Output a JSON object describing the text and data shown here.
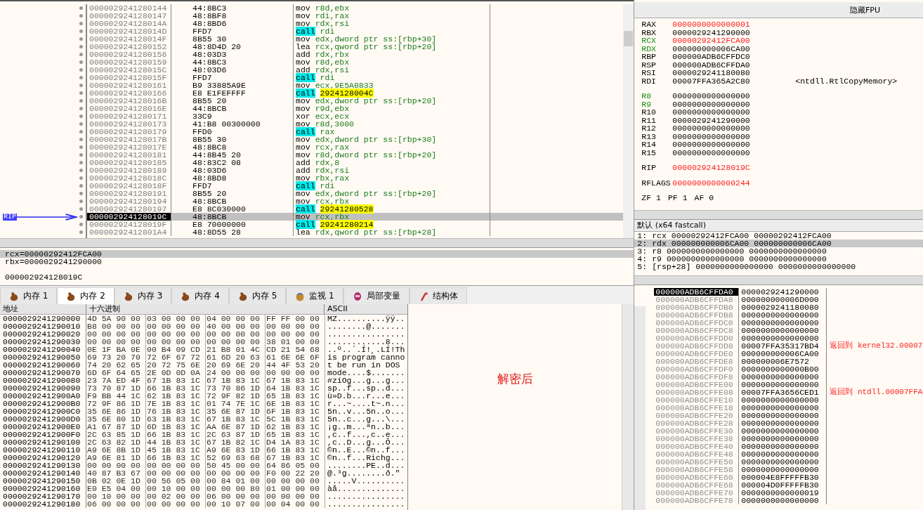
{
  "disassembly": {
    "rip_label": "RIP",
    "rows": [
      {
        "address": "0000029241280144",
        "bytes": "44:8BC3",
        "mnemonic": "mov",
        "operands": "r8d,ebx",
        "kind": "plain",
        "selected": false
      },
      {
        "address": "0000029241280147",
        "bytes": "48:8BF8",
        "mnemonic": "mov",
        "operands": "rdi,rax",
        "kind": "plain",
        "selected": false
      },
      {
        "address": "000002924128014A",
        "bytes": "48:8BD6",
        "mnemonic": "mov",
        "operands": "rdx,rsi",
        "kind": "plain",
        "selected": false
      },
      {
        "address": "000002924128014D",
        "bytes": "FFD7",
        "mnemonic": "call",
        "operands": "rdi",
        "kind": "call",
        "selected": false
      },
      {
        "address": "000002924128014F",
        "bytes": "8B55 30",
        "mnemonic": "mov",
        "operands": "edx,dword ptr ss:[rbp+30]",
        "kind": "plain",
        "selected": false
      },
      {
        "address": "0000029241280152",
        "bytes": "48:8D4D 20",
        "mnemonic": "lea",
        "operands": "rcx,qword ptr ss:[rbp+20]",
        "kind": "plain",
        "selected": false
      },
      {
        "address": "0000029241280156",
        "bytes": "48:03D3",
        "mnemonic": "add",
        "operands": "rdx,rbx",
        "kind": "plain",
        "selected": false
      },
      {
        "address": "0000029241280159",
        "bytes": "44:8BC3",
        "mnemonic": "mov",
        "operands": "r8d,ebx",
        "kind": "plain",
        "selected": false
      },
      {
        "address": "000002924128015C",
        "bytes": "48:03D6",
        "mnemonic": "add",
        "operands": "rdx,rsi",
        "kind": "plain",
        "selected": false
      },
      {
        "address": "000002924128015F",
        "bytes": "FFD7",
        "mnemonic": "call",
        "operands": "rdi",
        "kind": "call",
        "selected": false
      },
      {
        "address": "0000029241280161",
        "bytes": "B9 33885A9E",
        "mnemonic": "mov",
        "operands": "ecx,9E5A8833",
        "kind": "plain",
        "selected": false
      },
      {
        "address": "0000029241280166",
        "bytes": "E8 E1FEFFFF",
        "mnemonic": "call",
        "operands": "2924128004C",
        "kind": "call_address",
        "selected": false
      },
      {
        "address": "000002924128016B",
        "bytes": "8B55 20",
        "mnemonic": "mov",
        "operands": "edx,dword ptr ss:[rbp+20]",
        "kind": "plain",
        "selected": false
      },
      {
        "address": "000002924128016E",
        "bytes": "44:8BCB",
        "mnemonic": "mov",
        "operands": "r9d,ebx",
        "kind": "plain",
        "selected": false
      },
      {
        "address": "0000029241280171",
        "bytes": "33C9",
        "mnemonic": "xor",
        "operands": "ecx,ecx",
        "kind": "plain",
        "selected": false
      },
      {
        "address": "0000029241280173",
        "bytes": "41:B8 00300000",
        "mnemonic": "mov",
        "operands": "r8d,3000",
        "kind": "plain",
        "selected": false
      },
      {
        "address": "0000029241280179",
        "bytes": "FFD0",
        "mnemonic": "call",
        "operands": "rax",
        "kind": "call",
        "selected": false
      },
      {
        "address": "000002924128017B",
        "bytes": "8B55 30",
        "mnemonic": "mov",
        "operands": "edx,dword ptr ss:[rbp+30]",
        "kind": "plain",
        "selected": false
      },
      {
        "address": "000002924128017E",
        "bytes": "48:8BC8",
        "mnemonic": "mov",
        "operands": "rcx,rax",
        "kind": "plain",
        "selected": false
      },
      {
        "address": "0000029241280181",
        "bytes": "44:8B45 20",
        "mnemonic": "mov",
        "operands": "r8d,dword ptr ss:[rbp+20]",
        "kind": "plain",
        "selected": false
      },
      {
        "address": "0000029241280185",
        "bytes": "48:83C2 08",
        "mnemonic": "add",
        "operands": "rdx,8",
        "kind": "plain",
        "selected": false
      },
      {
        "address": "0000029241280189",
        "bytes": "48:03D6",
        "mnemonic": "add",
        "operands": "rdx,rsi",
        "kind": "plain",
        "selected": false
      },
      {
        "address": "000002924128018C",
        "bytes": "48:8BD8",
        "mnemonic": "mov",
        "operands": "rbx,rax",
        "kind": "plain",
        "selected": false
      },
      {
        "address": "000002924128018F",
        "bytes": "FFD7",
        "mnemonic": "call",
        "operands": "rdi",
        "kind": "call",
        "selected": false
      },
      {
        "address": "0000029241280191",
        "bytes": "8B55 20",
        "mnemonic": "mov",
        "operands": "edx,dword ptr ss:[rbp+20]",
        "kind": "plain",
        "selected": false
      },
      {
        "address": "0000029241280194",
        "bytes": "48:8BCB",
        "mnemonic": "mov",
        "operands": "rcx,rbx",
        "kind": "plain",
        "selected": false
      },
      {
        "address": "0000029241280197",
        "bytes": "E8 8C030000",
        "mnemonic": "call",
        "operands": "29241280528",
        "kind": "call_address",
        "selected": false
      },
      {
        "address": "000002924128019C",
        "bytes": "48:8BCB",
        "mnemonic": "mov",
        "operands": "rcx,rbx",
        "kind": "plain",
        "selected": true
      },
      {
        "address": "000002924128019F",
        "bytes": "E8 70000000",
        "mnemonic": "call",
        "operands": "29241280214",
        "kind": "call_address",
        "selected": false
      },
      {
        "address": "00000292412801A4",
        "bytes": "48:8D55 28",
        "mnemonic": "lea",
        "operands": "rdx,qword ptr ss:[rbp+28]",
        "kind": "plain",
        "selected": false
      }
    ]
  },
  "info": {
    "lines": [
      {
        "text": "rcx=00000292412FCA00",
        "selected": true
      },
      {
        "text": "rbx=0000029241290000",
        "selected": false
      }
    ],
    "address": "000002924128019C"
  },
  "tabs": [
    {
      "label": "内存 1",
      "kind": "memory",
      "selected": false
    },
    {
      "label": "内存 2",
      "kind": "memory",
      "selected": true
    },
    {
      "label": "内存 3",
      "kind": "memory",
      "selected": false
    },
    {
      "label": "内存 4",
      "kind": "memory",
      "selected": false
    },
    {
      "label": "内存 5",
      "kind": "memory",
      "selected": false
    },
    {
      "label": "监视 1",
      "kind": "watch",
      "selected": false
    },
    {
      "label": "局部变量",
      "kind": "locals",
      "selected": false
    },
    {
      "label": "结构体",
      "kind": "struct",
      "selected": false
    }
  ],
  "dump": {
    "columns": [
      "地址",
      "十六进制",
      "ASCII"
    ],
    "annotation": "解密后",
    "rows": [
      {
        "address": "0000029241290000",
        "groups": [
          "4D 5A 90 00",
          "03 00 00 00",
          "04 00 00 00",
          "FF FF 00 00"
        ],
        "ascii": "MZ..........ÿÿ.."
      },
      {
        "address": "0000029241290010",
        "groups": [
          "B8 00 00 00",
          "00 00 00 00",
          "40 00 00 00",
          "00 00 00 00"
        ],
        "ascii": "........@......."
      },
      {
        "address": "0000029241290020",
        "groups": [
          "00 00 00 00",
          "00 00 00 00",
          "00 00 00 00",
          "00 00 00 00"
        ],
        "ascii": "................"
      },
      {
        "address": "0000029241290030",
        "groups": [
          "00 00 00 00",
          "00 00 00 00",
          "00 00 00 00",
          "38 01 00 00"
        ],
        "ascii": "............8..."
      },
      {
        "address": "0000029241290040",
        "groups": [
          "0E 1F BA 0E",
          "00 B4 09 CD",
          "21 B8 01 4C",
          "CD 21 54 68"
        ],
        "ascii": "..º..´.Í!¸.LÍ!Th"
      },
      {
        "address": "0000029241290050",
        "groups": [
          "69 73 20 70",
          "72 6F 67 72",
          "61 6D 20 63",
          "61 6E 6E 6F"
        ],
        "ascii": "is program canno"
      },
      {
        "address": "0000029241290060",
        "groups": [
          "74 20 62 65",
          "20 72 75 6E",
          "20 69 6E 20",
          "44 4F 53 20"
        ],
        "ascii": "t be run in DOS "
      },
      {
        "address": "0000029241290070",
        "groups": [
          "6D 6F 64 65",
          "2E 0D 0D 0A",
          "24 00 00 00",
          "00 00 00 00"
        ],
        "ascii": "mode....$......."
      },
      {
        "address": "0000029241290080",
        "groups": [
          "23 7A ED 4F",
          "67 1B 83 1C",
          "67 1B 83 1C",
          "67 1B 83 1C"
        ],
        "ascii": "#zíOg...g...g..."
      },
      {
        "address": "0000029241290090",
        "groups": [
          "73 70 87 1D",
          "66 1B 83 1C",
          "73 70 86 1D",
          "64 1B 83 1C"
        ],
        "ascii": "sp..f...sp..d..."
      },
      {
        "address": "00000292412900A0",
        "groups": [
          "F9 BB 44 1C",
          "62 1B 83 1C",
          "72 9F 82 1D",
          "65 1B 83 1C"
        ],
        "ascii": "ù»D.b...r...e..."
      },
      {
        "address": "00000292412900B0",
        "groups": [
          "72 9F 86 1D",
          "7E 1B 83 1C",
          "01 74 7E 1C",
          "6E 1B 83 1C"
        ],
        "ascii": "r...~....t~.n..."
      },
      {
        "address": "00000292412900C0",
        "groups": [
          "35 6E 86 1D",
          "76 1B 83 1C",
          "35 6E 87 1D",
          "6F 1B 83 1C"
        ],
        "ascii": "5n..v...5n..o..."
      },
      {
        "address": "00000292412900D0",
        "groups": [
          "35 6E 80 1D",
          "63 1B 83 1C",
          "67 1B 83 1C",
          "5C 1B 83 1C"
        ],
        "ascii": "5n..c...g...\\..."
      },
      {
        "address": "00000292412900E0",
        "groups": [
          "A1 67 87 1D",
          "6D 1B 83 1C",
          "AA 6E 87 1D",
          "62 1B 83 1C"
        ],
        "ascii": "¡g..m...ªn..b..."
      },
      {
        "address": "00000292412900F0",
        "groups": [
          "2C 63 85 1D",
          "66 1B 83 1C",
          "2C 63 87 1D",
          "65 1B 83 1C"
        ],
        "ascii": ",c..f...,c..e..."
      },
      {
        "address": "0000029241290100",
        "groups": [
          "2C 63 82 1D",
          "44 1B 83 1C",
          "67 1B 82 1C",
          "D4 1A 83 1C"
        ],
        "ascii": ",c..D...g...Ô..."
      },
      {
        "address": "0000029241290110",
        "groups": [
          "A9 6E 8B 1D",
          "45 1B 83 1C",
          "A9 6E 83 1D",
          "66 1B 83 1C"
        ],
        "ascii": "©n..E...©n..f..."
      },
      {
        "address": "0000029241290120",
        "groups": [
          "A9 6E 81 1D",
          "66 1B 83 1C",
          "52 69 63 68",
          "67 1B 83 1C"
        ],
        "ascii": "©n..f...Richg..."
      },
      {
        "address": "0000029241290130",
        "groups": [
          "00 00 00 00",
          "00 00 00 00",
          "50 45 00 00",
          "64 86 05 00"
        ],
        "ascii": "........PE..d..."
      },
      {
        "address": "0000029241290140",
        "groups": [
          "40 87 B3 67",
          "00 00 00 00",
          "00 00 00 00",
          "F0 00 22 20"
        ],
        "ascii": "@.³g........ð.\" "
      },
      {
        "address": "0000029241290150",
        "groups": [
          "0B 02 0E 1D",
          "00 56 05 00",
          "00 84 01 00",
          "00 00 00 00"
        ],
        "ascii": ".....V.........."
      },
      {
        "address": "0000029241290160",
        "groups": [
          "E0 E5 04 00",
          "00 10 00 00",
          "00 00 00 80",
          "01 00 00 00"
        ],
        "ascii": "àå.............."
      },
      {
        "address": "0000029241290170",
        "groups": [
          "00 10 00 00",
          "00 02 00 00",
          "06 00 00 00",
          "00 00 00 00"
        ],
        "ascii": "................"
      },
      {
        "address": "0000029241290180",
        "groups": [
          "06 00 00 00",
          "00 00 00 00",
          "00 10 07 00",
          "00 04 00 00"
        ],
        "ascii": "................"
      }
    ]
  },
  "registers": {
    "button": "隐藏FPU",
    "groups": [
      [
        {
          "name": "RAX",
          "value": "0000000000000001",
          "argument": false,
          "modified": true
        },
        {
          "name": "RBX",
          "value": "0000029241290000",
          "argument": false,
          "modified": false
        },
        {
          "name": "RCX",
          "value": "00000292412FCA00",
          "argument": true,
          "modified": true
        },
        {
          "name": "RDX",
          "value": "000000000006CA00",
          "argument": true,
          "modified": false
        },
        {
          "name": "RBP",
          "value": "000000ADB6CFFDC0",
          "argument": false,
          "modified": false
        },
        {
          "name": "RSP",
          "value": "000000ADB6CFFDA0",
          "argument": false,
          "modified": false
        },
        {
          "name": "RSI",
          "value": "0000029241180080",
          "argument": false,
          "modified": false
        },
        {
          "name": "RDI",
          "value": "00007FFA365A2C80",
          "argument": false,
          "modified": false,
          "comment": "<ntdll.RtlCopyMemory>"
        }
      ],
      [
        {
          "name": "R8",
          "value": "0000000000000000",
          "argument": true,
          "modified": false
        },
        {
          "name": "R9",
          "value": "0000000000000000",
          "argument": true,
          "modified": false
        },
        {
          "name": "R10",
          "value": "0000000000000000",
          "argument": false,
          "modified": false
        },
        {
          "name": "R11",
          "value": "0000029241290000",
          "argument": false,
          "modified": false
        },
        {
          "name": "R12",
          "value": "0000000000000000",
          "argument": false,
          "modified": false
        },
        {
          "name": "R13",
          "value": "0000000000000000",
          "argument": false,
          "modified": false
        },
        {
          "name": "R14",
          "value": "0000000000000000",
          "argument": false,
          "modified": false
        },
        {
          "name": "R15",
          "value": "0000000000000000",
          "argument": false,
          "modified": false
        }
      ],
      [
        {
          "name": "RIP",
          "value": "000002924128019C",
          "argument": false,
          "modified": true
        }
      ],
      [
        {
          "name": "RFLAGS",
          "value": "0000000000000244",
          "argument": false,
          "modified": true
        }
      ]
    ],
    "flags": [
      {
        "name": "ZF",
        "value": "1"
      },
      {
        "name": "PF",
        "value": "1"
      },
      {
        "name": "AF",
        "value": "0"
      }
    ]
  },
  "call_convention": {
    "title": "默认 (x64 fastcall)",
    "rows": [
      {
        "index": "1:",
        "location": "rcx",
        "value": "00000292412FCA00",
        "content": "00000292412FCA00",
        "selected": false
      },
      {
        "index": "2:",
        "location": "rdx",
        "value": "000000000006CA00",
        "content": "000000000006CA00",
        "selected": true
      },
      {
        "index": "3:",
        "location": "r8",
        "value": "0000000000000000",
        "content": "0000000000000000",
        "selected": false
      },
      {
        "index": "4:",
        "location": "r9",
        "value": "0000000000000000",
        "content": "0000000000000000",
        "selected": false
      },
      {
        "index": "5:",
        "location": "[rsp+28]",
        "value": "0000000000000000",
        "content": "0000000000000000",
        "selected": false
      }
    ]
  },
  "stack": {
    "rows": [
      {
        "address": "000000ADB6CFFDA0",
        "value": "0000029241290000",
        "selected": true
      },
      {
        "address": "000000ADB6CFFDA8",
        "value": "000000000006D000",
        "selected": false
      },
      {
        "address": "000000ADB6CFFDB0",
        "value": "0000029241180080",
        "selected": false
      },
      {
        "address": "000000ADB6CFFDB8",
        "value": "0000000000000000",
        "selected": false
      },
      {
        "address": "000000ADB6CFFDC0",
        "value": "0000000000000000",
        "selected": false
      },
      {
        "address": "000000ADB6CFFDC8",
        "value": "0000000000000000",
        "selected": false
      },
      {
        "address": "000000ADB6CFFDD0",
        "value": "0000000000000000",
        "selected": false
      },
      {
        "address": "000000ADB6CFFDD8",
        "value": "00007FFA35317BD4",
        "selected": false,
        "comment": "返回到 kernel32.00007"
      },
      {
        "address": "000000ADB6CFFDE0",
        "value": "000000000006CA00",
        "selected": false
      },
      {
        "address": "000000ADB6CFFDE8",
        "value": "000000006E7572",
        "selected": false
      },
      {
        "address": "000000ADB6CFFDF0",
        "value": "0000000000000B00",
        "selected": false
      },
      {
        "address": "000000ADB6CFFDF8",
        "value": "0000000000000000",
        "selected": false
      },
      {
        "address": "000000ADB6CFFE00",
        "value": "0000000000000000",
        "selected": false
      },
      {
        "address": "000000ADB6CFFE08",
        "value": "00007FFA3656CED1",
        "selected": false,
        "comment": "返回到 ntdll.00007FFA"
      },
      {
        "address": "000000ADB6CFFE10",
        "value": "0000000000000000",
        "selected": false
      },
      {
        "address": "000000ADB6CFFE18",
        "value": "0000000000000000",
        "selected": false
      },
      {
        "address": "000000ADB6CFFE20",
        "value": "0000000000000000",
        "selected": false
      },
      {
        "address": "000000ADB6CFFE28",
        "value": "0000000000000000",
        "selected": false
      },
      {
        "address": "000000ADB6CFFE30",
        "value": "0000000000000000",
        "selected": false
      },
      {
        "address": "000000ADB6CFFE38",
        "value": "0000000000000000",
        "selected": false
      },
      {
        "address": "000000ADB6CFFE40",
        "value": "0000000000000000",
        "selected": false
      },
      {
        "address": "000000ADB6CFFE48",
        "value": "0000000000000000",
        "selected": false
      },
      {
        "address": "000000ADB6CFFE50",
        "value": "0000000000000000",
        "selected": false
      },
      {
        "address": "000000ADB6CFFE58",
        "value": "0000000000000000",
        "selected": false
      },
      {
        "address": "000000ADB6CFFE60",
        "value": "000004E8FFFFFB30",
        "selected": false
      },
      {
        "address": "000000ADB6CFFE68",
        "value": "000004D0FFFFFB30",
        "selected": false
      },
      {
        "address": "000000ADB6CFFE70",
        "value": "0000000000000019",
        "selected": false
      },
      {
        "address": "000000ADB6CFFE78",
        "value": "0000000000000000",
        "selected": false
      }
    ]
  }
}
